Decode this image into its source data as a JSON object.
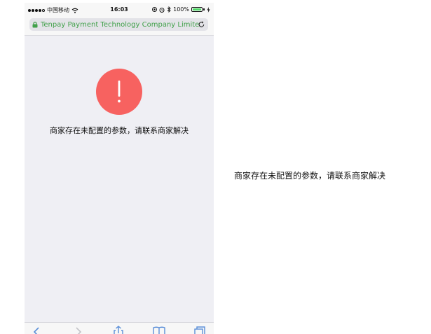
{
  "status_bar": {
    "carrier": "中国移动",
    "time": "16:03",
    "battery_percent": "100%",
    "battery_level": 1.0
  },
  "browser": {
    "url_text": "Tenpay Payment Technology Company Limited"
  },
  "error": {
    "symbol": "!",
    "message": "商家存在未配置的参数，请联系商家解决"
  },
  "side_caption": "商家存在未配置的参数，请联系商家解决",
  "colors": {
    "error_red": "#f76260",
    "secure_green": "#42a14b",
    "battery_green": "#4cd964",
    "toolbar_blue": "#5b8fd8"
  },
  "icons": {
    "lock": "lock-icon",
    "reload": "reload-icon",
    "back": "back-icon",
    "forward": "forward-icon",
    "share": "share-icon",
    "bookmarks": "bookmarks-icon",
    "tabs": "tabs-icon"
  }
}
